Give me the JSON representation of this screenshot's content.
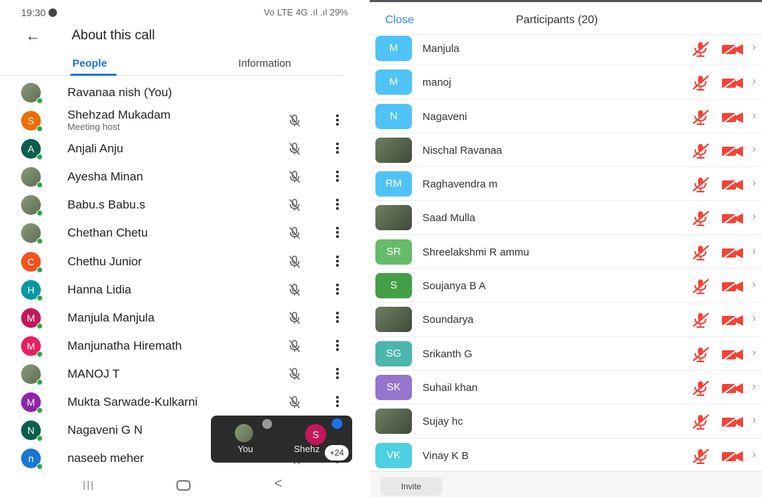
{
  "left": {
    "status": {
      "time": "19:30",
      "right": "Vo LTE 4G .ıl .ıl 29%"
    },
    "title": "About this call",
    "tabs": {
      "people": "People",
      "information": "Information"
    },
    "people": [
      {
        "name": "Ravanaa nish (You)",
        "subtitle": "",
        "initial": "",
        "color": "",
        "photo": true,
        "you": true
      },
      {
        "name": "Shehzad Mukadam",
        "subtitle": "Meeting host",
        "initial": "S",
        "color": "#ef6c00",
        "photo": false,
        "you": false
      },
      {
        "name": "Anjali Anju",
        "subtitle": "",
        "initial": "A",
        "color": "#0b5e4e",
        "photo": false,
        "you": false
      },
      {
        "name": "Ayesha Minan",
        "subtitle": "",
        "initial": "",
        "color": "",
        "photo": true,
        "you": false
      },
      {
        "name": "Babu.s Babu.s",
        "subtitle": "",
        "initial": "",
        "color": "",
        "photo": true,
        "you": false
      },
      {
        "name": "Chethan Chetu",
        "subtitle": "",
        "initial": "",
        "color": "",
        "photo": true,
        "you": false
      },
      {
        "name": "Chethu Junior",
        "subtitle": "",
        "initial": "C",
        "color": "#f4511e",
        "photo": false,
        "you": false
      },
      {
        "name": "Hanna Lidia",
        "subtitle": "",
        "initial": "H",
        "color": "#0097a7",
        "photo": false,
        "you": false
      },
      {
        "name": "Manjula Manjula",
        "subtitle": "",
        "initial": "M",
        "color": "#c2185b",
        "photo": false,
        "you": false
      },
      {
        "name": "Manjunatha Hiremath",
        "subtitle": "",
        "initial": "M",
        "color": "#e91e63",
        "photo": false,
        "you": false
      },
      {
        "name": "MANOJ T",
        "subtitle": "",
        "initial": "",
        "color": "",
        "photo": true,
        "you": false
      },
      {
        "name": "Mukta Sarwade-Kulkarni",
        "subtitle": "",
        "initial": "M",
        "color": "#8e24aa",
        "photo": false,
        "you": false
      },
      {
        "name": "Nagaveni G N",
        "subtitle": "",
        "initial": "N",
        "color": "#0b5e4e",
        "photo": false,
        "you": false
      },
      {
        "name": "naseeb meher",
        "subtitle": "",
        "initial": "n",
        "color": "#1976d2",
        "photo": false,
        "you": false
      }
    ],
    "overlay": {
      "you_label": "You",
      "other_initial": "S",
      "other_label": "Shehz",
      "more_count": "+24"
    }
  },
  "right": {
    "close": "Close",
    "title": "Participants (20)",
    "invite": "Invite",
    "participants": [
      {
        "name": "Manjula",
        "initial": "M",
        "color": "#4fc3f7",
        "photo": false
      },
      {
        "name": "manoj",
        "initial": "M",
        "color": "#4fc3f7",
        "photo": false
      },
      {
        "name": "Nagaveni",
        "initial": "N",
        "color": "#4fc3f7",
        "photo": false
      },
      {
        "name": "Nischal Ravanaa",
        "initial": "",
        "color": "",
        "photo": true
      },
      {
        "name": "Raghavendra m",
        "initial": "RM",
        "color": "#4fc3f7",
        "photo": false
      },
      {
        "name": "Saad Mulla",
        "initial": "",
        "color": "",
        "photo": true
      },
      {
        "name": "Shreelakshmi R ammu",
        "initial": "SR",
        "color": "#66bb6a",
        "photo": false
      },
      {
        "name": "Soujanya B A",
        "initial": "S",
        "color": "#43a047",
        "photo": false
      },
      {
        "name": "Soundarya",
        "initial": "",
        "color": "",
        "photo": true
      },
      {
        "name": "Srikanth G",
        "initial": "SG",
        "color": "#4db6ac",
        "photo": false
      },
      {
        "name": "Suhail khan",
        "initial": "SK",
        "color": "#9575cd",
        "photo": false
      },
      {
        "name": "Sujay hc",
        "initial": "",
        "color": "",
        "photo": true
      },
      {
        "name": "Vinay K B",
        "initial": "VK",
        "color": "#4dd0e1",
        "photo": false
      }
    ]
  }
}
